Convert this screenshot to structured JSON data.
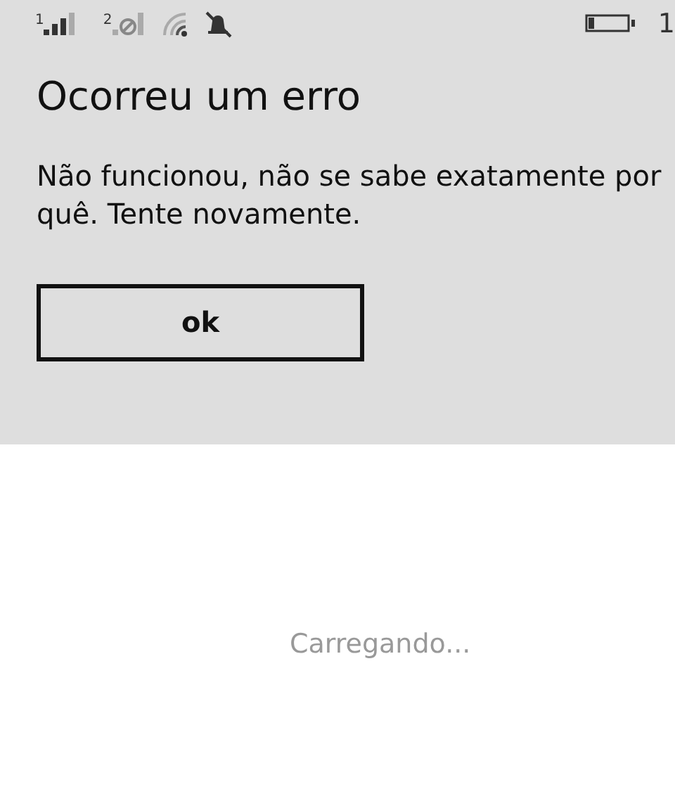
{
  "status_bar": {
    "sim_1": "1",
    "sim_2": "2",
    "battery": {
      "level": 0.15
    },
    "clock": "1"
  },
  "dialog": {
    "title": "Ocorreu um erro",
    "message": "Não funcionou, não se sabe exatamente por quê. Tente novamente.",
    "buttons": [
      "ok"
    ]
  },
  "loading_text": "Carregando..."
}
